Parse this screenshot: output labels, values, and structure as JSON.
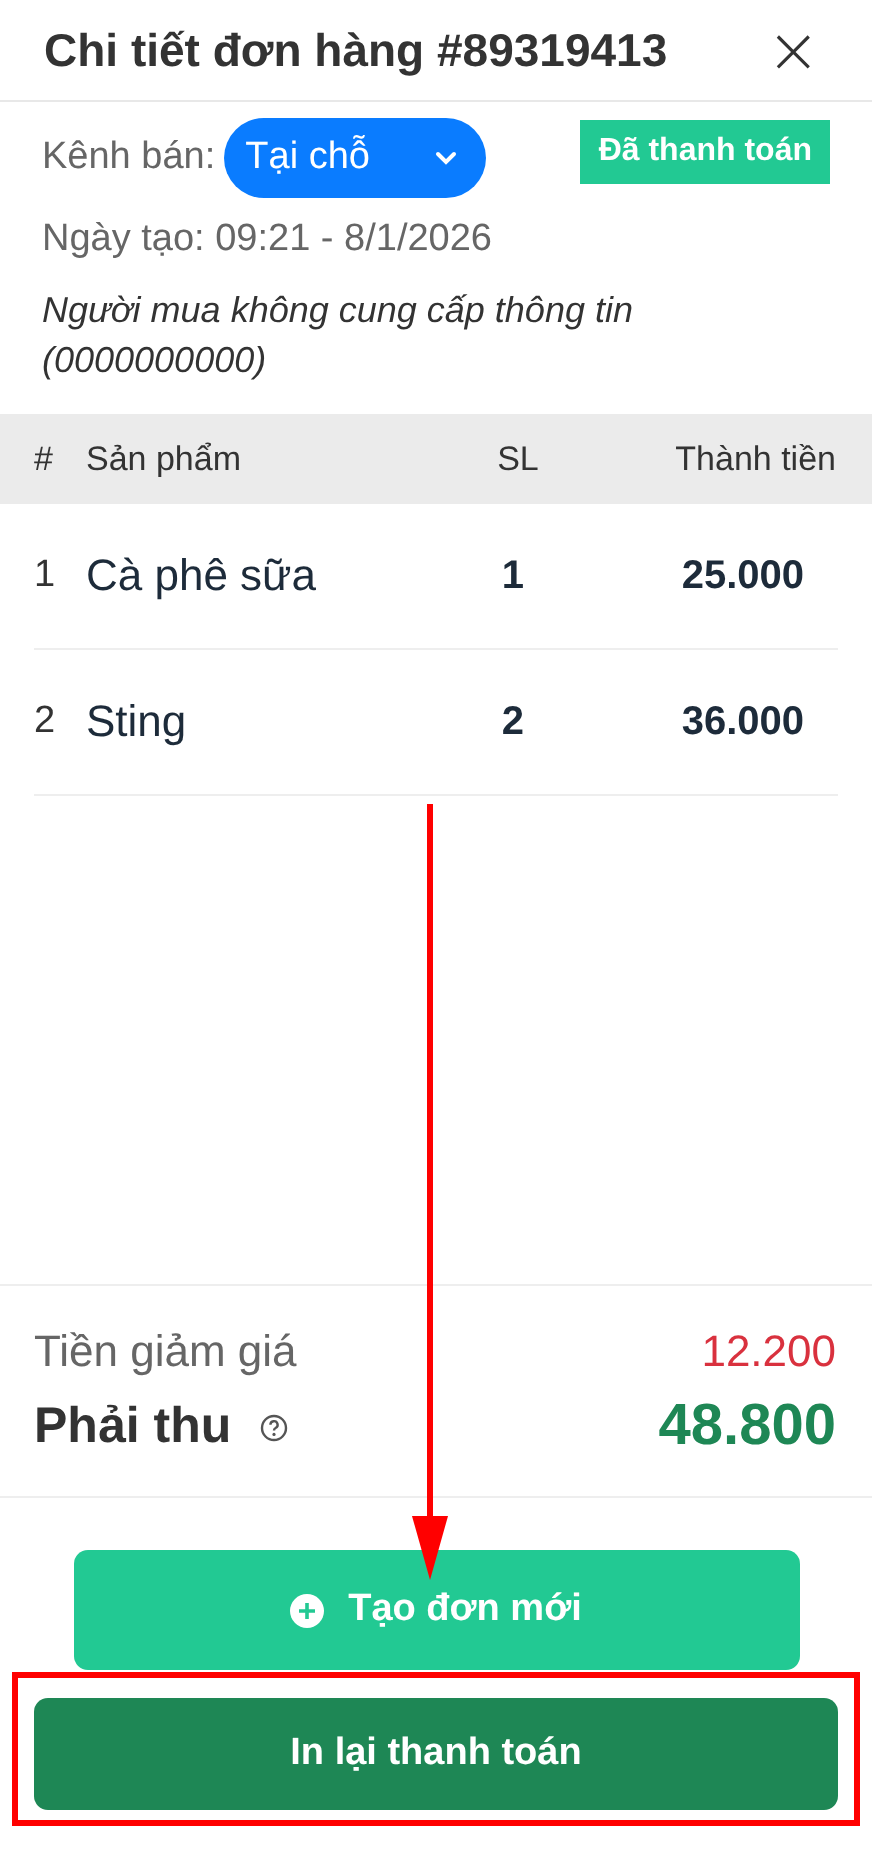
{
  "header": {
    "title": "Chi tiết đơn hàng #89319413",
    "close": "×"
  },
  "channel": {
    "label": "Kênh bán:",
    "value": "Tại chỗ"
  },
  "status_badge": "Đã thanh toán",
  "created": "Ngày tạo: 09:21 - 8/1/2026",
  "buyer_note": "Người mua không cung cấp thông tin (0000000000)",
  "table": {
    "columns": [
      "#",
      "Sản phẩm",
      "SL",
      "Thành tiền"
    ],
    "rows": [
      {
        "index": "1",
        "product": "Cà phê sữa",
        "qty": "1",
        "amount": "25.000"
      },
      {
        "index": "2",
        "product": "Sting",
        "qty": "2",
        "amount": "36.000"
      }
    ]
  },
  "summary": {
    "discount_label": "Tiền giảm giá",
    "discount": "12.200",
    "due_label": "Phải thu",
    "due": "48.800"
  },
  "buttons": [
    {
      "kind": "secondary",
      "label": "Tạo đơn mới"
    },
    {
      "kind": "primary",
      "label": "In lại thanh toán"
    }
  ]
}
